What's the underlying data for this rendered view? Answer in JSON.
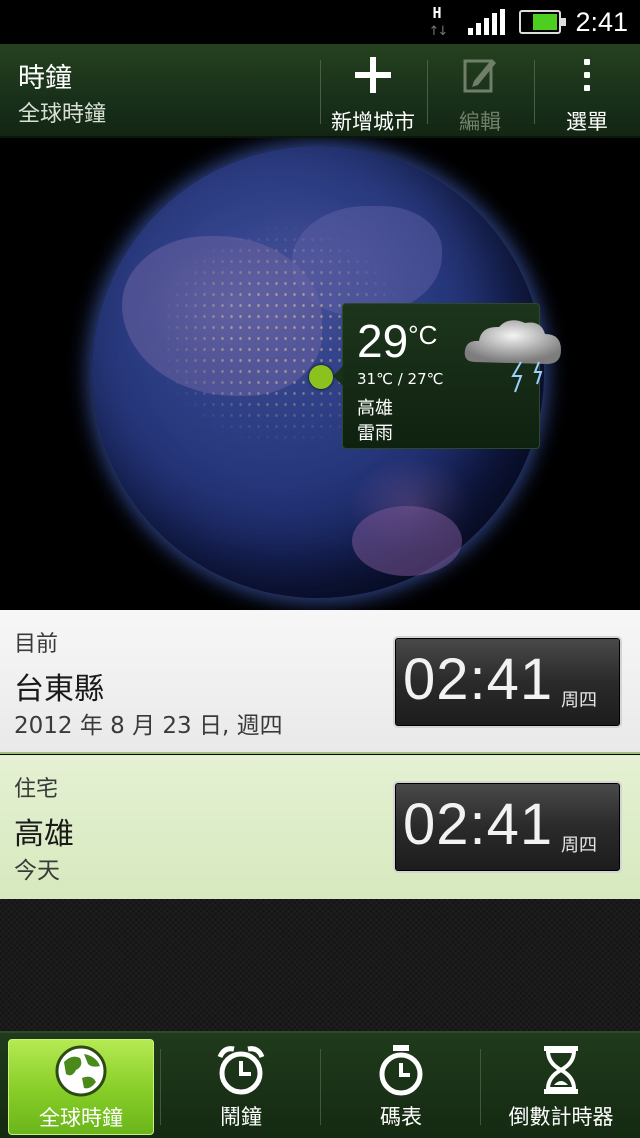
{
  "status_bar": {
    "network_type": "H",
    "network_icon": "data-arrows-icon",
    "signal_icon": "signal-icon",
    "battery_icon": "battery-icon",
    "battery_level": 0.7,
    "time": "2:41"
  },
  "action_bar": {
    "title": "時鐘",
    "subtitle": "全球時鐘",
    "buttons": [
      {
        "label": "新增城市",
        "icon": "plus-icon",
        "enabled": true
      },
      {
        "label": "編輯",
        "icon": "edit-icon",
        "enabled": false
      },
      {
        "label": "選單",
        "icon": "more-icon",
        "enabled": true
      }
    ]
  },
  "globe": {
    "weather": {
      "temp": "29",
      "unit": "°C",
      "range": "31℃ / 27℃",
      "city": "高雄",
      "condition": "雷雨",
      "icon": "thunderstorm-cloud-icon"
    },
    "marker_color": "#8cc21e"
  },
  "clocks": [
    {
      "label": "目前",
      "city": "台東縣",
      "detail": "2012 年 8 月 23 日, 週四",
      "time": "02:41",
      "day": "周四"
    },
    {
      "label": "住宅",
      "city": "高雄",
      "detail": "今天",
      "time": "02:41",
      "day": "周四"
    }
  ],
  "tabs": [
    {
      "label": "全球時鐘",
      "icon": "globe-icon",
      "active": true
    },
    {
      "label": "鬧鐘",
      "icon": "alarm-clock-icon",
      "active": false
    },
    {
      "label": "碼表",
      "icon": "stopwatch-icon",
      "active": false
    },
    {
      "label": "倒數計時器",
      "icon": "hourglass-icon",
      "active": false
    }
  ],
  "colors": {
    "accent_green": "#86cd27",
    "header_green": "#18301a",
    "home_row": "#d7e9be"
  }
}
